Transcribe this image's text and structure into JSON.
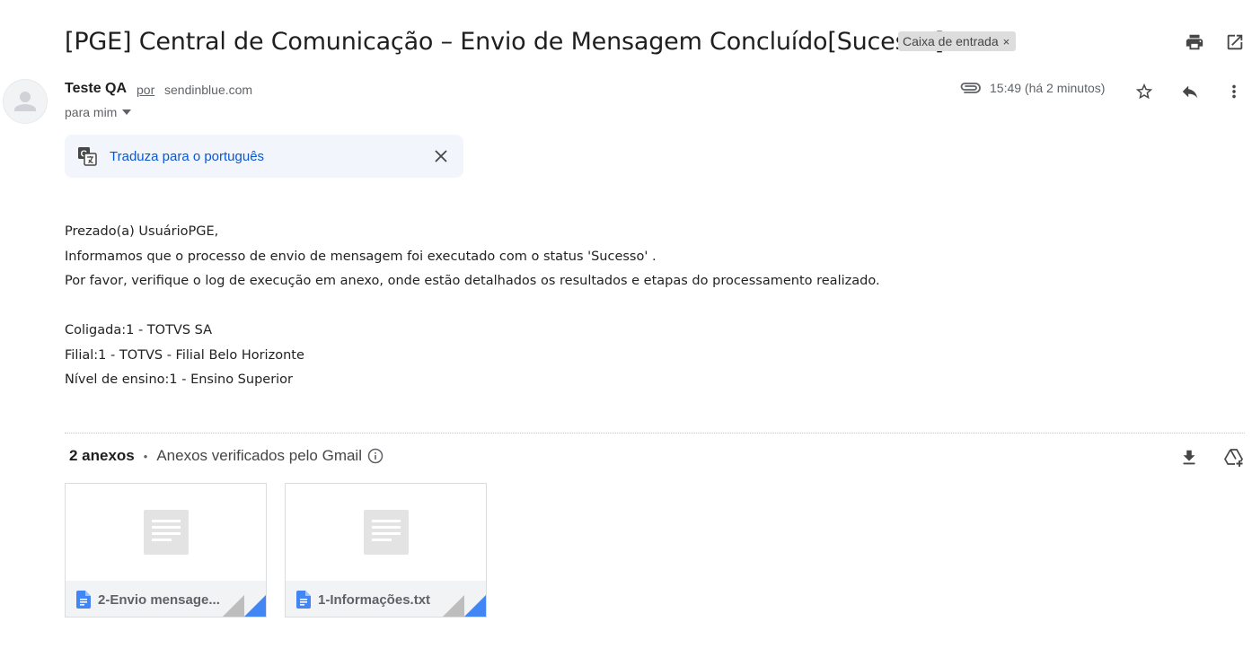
{
  "email": {
    "subject": "[PGE] Central de Comunicação – Envio de Mensagem Concluído[Sucesso]",
    "label": "Caixa de entrada",
    "label_remove": "×",
    "sender": {
      "name": "Teste QA",
      "via_word": "por",
      "via_domain": "sendinblue.com",
      "recipient": "para mim"
    },
    "time": "15:49 (há 2 minutos)",
    "translate": {
      "link": "Traduza para o português"
    },
    "body_lines": [
      "Prezado(a) UsuárioPGE,",
      "Informamos que o processo de envio de mensagem foi executado com o status 'Sucesso' .",
      "Por favor, verifique o log de execução em anexo, onde estão detalhados os resultados e etapas do processamento realizado.",
      "Coligada:1 - TOTVS SA",
      "Filial:1 - TOTVS - Filial Belo Horizonte",
      "Nível de ensino:1 - Ensino Superior"
    ]
  },
  "attachments": {
    "count_label": "2 anexos",
    "separator": "•",
    "verified_label": "Anexos verificados pelo Gmail",
    "items": [
      {
        "name": "2-Envio mensage..."
      },
      {
        "name": "1-Informações.txt"
      }
    ]
  },
  "icons": {
    "print": "print-icon",
    "open_new": "open-in-new-window-icon",
    "attachment": "paperclip-icon",
    "star": "star-icon",
    "reply": "reply-icon",
    "more": "more-vert-icon",
    "translate": "translate-icon",
    "close": "close-icon",
    "info": "info-icon",
    "download": "download-icon",
    "drive": "add-to-drive-icon",
    "doc": "google-docs-icon"
  },
  "colors": {
    "link_blue": "#0b57d0",
    "translate_bg": "#f2f6fc",
    "label_chip_bg": "#dddddd",
    "doc_blue": "#4285f4"
  }
}
